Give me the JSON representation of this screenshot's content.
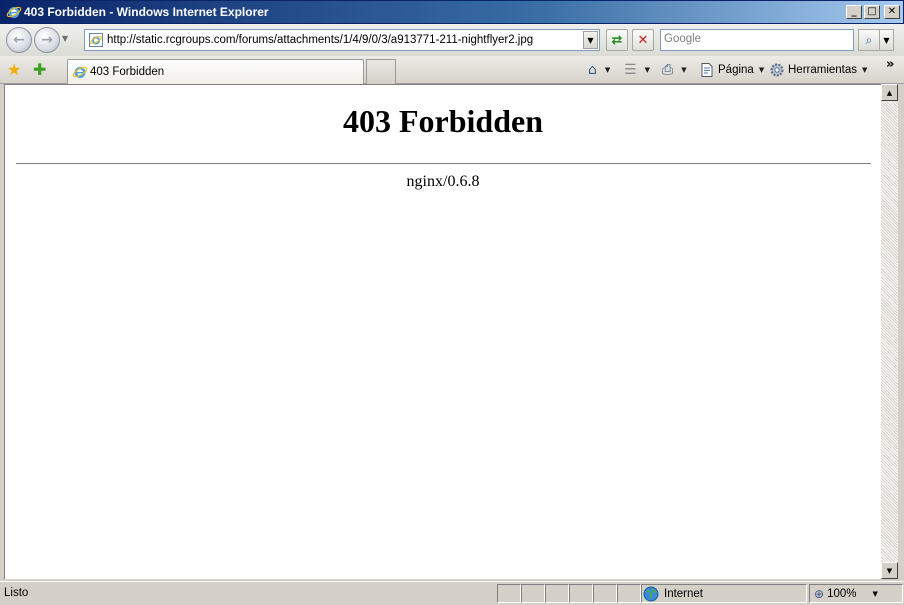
{
  "window": {
    "title": "403 Forbidden - Windows Internet Explorer",
    "minimize_glyph": "_",
    "maximize_glyph": "□",
    "close_glyph": "✕"
  },
  "navigation": {
    "back_glyph": "←",
    "forward_glyph": "→",
    "address": "http://static.rcgroups.com/forums/attachments/1/4/9/0/3/a913771-211-nightflyer2.jpg",
    "refresh_glyph": "⇄",
    "stop_glyph": "✕",
    "search_placeholder": "Google",
    "search_glyph": "⌕"
  },
  "tabs": [
    {
      "label": "403 Forbidden"
    }
  ],
  "command_bar": {
    "home_glyph": "⌂",
    "feeds_glyph": "☰",
    "print_glyph": "⎙",
    "page_label": "Página",
    "tools_label": "Herramientas",
    "more_glyph": "»"
  },
  "page": {
    "heading": "403 Forbidden",
    "server": "nginx/0.6.8"
  },
  "status_bar": {
    "status": "Listo",
    "zone": "Internet",
    "zoom": "100%"
  },
  "colors": {
    "titlebar_start": "#0a246a",
    "titlebar_end": "#a6caf0",
    "chrome": "#d4d0c8"
  },
  "icons": [
    "ie-logo-icon",
    "back-arrow-icon",
    "forward-arrow-icon",
    "refresh-icon",
    "stop-icon",
    "search-icon",
    "favorites-star-icon",
    "add-favorites-icon",
    "home-icon",
    "feeds-icon",
    "print-icon",
    "page-icon",
    "tools-gear-icon",
    "internet-globe-icon",
    "zoom-icon"
  ]
}
